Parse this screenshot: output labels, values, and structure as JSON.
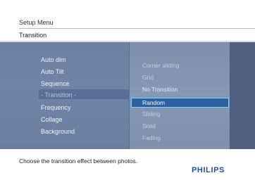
{
  "header": {
    "title": "Setup Menu",
    "subtitle": "Transition"
  },
  "menu": {
    "items": [
      "Auto dim",
      "Auto Tilt",
      "Sequence",
      "- Transition -",
      "Frequency",
      "Collage",
      "Background"
    ],
    "selected_index": 3
  },
  "submenu": {
    "items": [
      "Corner sliding",
      "Grid",
      "No Transition",
      "Random",
      "Sliding",
      "Snail",
      "Fading"
    ],
    "highlighted_index": 3
  },
  "footer": {
    "hint": "Choose the transition effect between photos.",
    "brand": "PHILIPS"
  },
  "colors": {
    "brand": "#1f4fa3",
    "highlight_fill": "#2e5f9e",
    "highlight_border": "#7bd3ff",
    "menu_bg": "#6f84a6"
  }
}
